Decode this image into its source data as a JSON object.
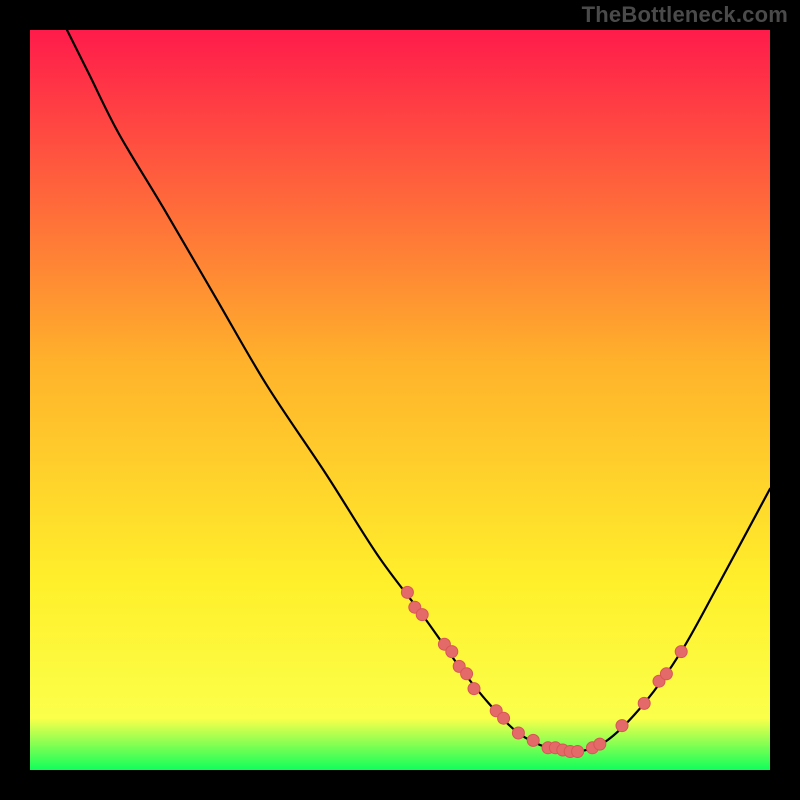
{
  "watermark": "TheBottleneck.com",
  "colors": {
    "background_black": "#000000",
    "gradient_stops": [
      {
        "offset": "0%",
        "color": "#ff1b4b"
      },
      {
        "offset": "45%",
        "color": "#ffb22b"
      },
      {
        "offset": "75%",
        "color": "#fff02b"
      },
      {
        "offset": "93%",
        "color": "#fbff4a"
      },
      {
        "offset": "100%",
        "color": "#10ff5a"
      }
    ],
    "curve_stroke": "#000000",
    "point_fill": "#e46a6a",
    "point_stroke": "#d95555"
  },
  "chart_data": {
    "type": "line",
    "title": "",
    "xlabel": "",
    "ylabel": "",
    "xlim": [
      0,
      100
    ],
    "ylim": [
      0,
      100
    ],
    "curve": [
      {
        "x": 5,
        "y": 100
      },
      {
        "x": 8,
        "y": 94
      },
      {
        "x": 12,
        "y": 86
      },
      {
        "x": 18,
        "y": 76
      },
      {
        "x": 25,
        "y": 64
      },
      {
        "x": 32,
        "y": 52
      },
      {
        "x": 40,
        "y": 40
      },
      {
        "x": 47,
        "y": 29
      },
      {
        "x": 53,
        "y": 21
      },
      {
        "x": 58,
        "y": 14
      },
      {
        "x": 62,
        "y": 9
      },
      {
        "x": 66,
        "y": 5
      },
      {
        "x": 70,
        "y": 3
      },
      {
        "x": 74,
        "y": 2.5
      },
      {
        "x": 78,
        "y": 4
      },
      {
        "x": 83,
        "y": 9
      },
      {
        "x": 88,
        "y": 16
      },
      {
        "x": 93,
        "y": 25
      },
      {
        "x": 100,
        "y": 38
      }
    ],
    "points": [
      {
        "x": 51,
        "y": 24
      },
      {
        "x": 52,
        "y": 22
      },
      {
        "x": 53,
        "y": 21
      },
      {
        "x": 56,
        "y": 17
      },
      {
        "x": 57,
        "y": 16
      },
      {
        "x": 58,
        "y": 14
      },
      {
        "x": 59,
        "y": 13
      },
      {
        "x": 60,
        "y": 11
      },
      {
        "x": 63,
        "y": 8
      },
      {
        "x": 64,
        "y": 7
      },
      {
        "x": 66,
        "y": 5
      },
      {
        "x": 68,
        "y": 4
      },
      {
        "x": 70,
        "y": 3
      },
      {
        "x": 71,
        "y": 3
      },
      {
        "x": 72,
        "y": 2.7
      },
      {
        "x": 73,
        "y": 2.5
      },
      {
        "x": 74,
        "y": 2.5
      },
      {
        "x": 76,
        "y": 3
      },
      {
        "x": 77,
        "y": 3.5
      },
      {
        "x": 80,
        "y": 6
      },
      {
        "x": 83,
        "y": 9
      },
      {
        "x": 85,
        "y": 12
      },
      {
        "x": 86,
        "y": 13
      },
      {
        "x": 88,
        "y": 16
      }
    ],
    "point_radius": 6
  }
}
